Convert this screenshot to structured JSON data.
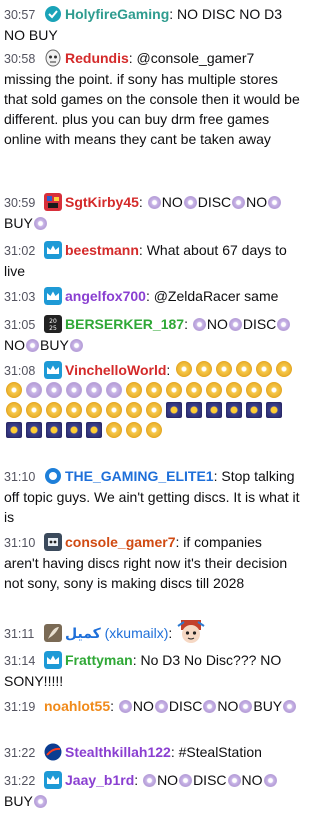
{
  "messages": [
    {
      "time": "30:57",
      "user": "HolyfireGaming",
      "color": "#2e9c8f",
      "badge": "circle-teal",
      "parts": [
        {
          "t": "text",
          "v": ": NO DISC NO D3 NO BUY"
        }
      ]
    },
    {
      "time": "30:58",
      "user": "Redundis",
      "color": "#d42a2a",
      "badge": "mask",
      "parts": [
        {
          "t": "text",
          "v": ": @console_gamer7 missing the point. if sony has multiple stores that sold games on the console then it would be different. plus you can buy drm free games online with means they cant be taken away"
        }
      ]
    },
    {
      "time": "30:59",
      "user": "SgtKirby45",
      "color": "#d42a2a",
      "badge": "pixel",
      "parts": [
        {
          "t": "text",
          "v": ": "
        },
        {
          "t": "emote"
        },
        {
          "t": "text",
          "v": "NO"
        },
        {
          "t": "emote"
        },
        {
          "t": "text",
          "v": "DISC"
        },
        {
          "t": "emote"
        },
        {
          "t": "text",
          "v": "NO"
        },
        {
          "t": "emote"
        },
        {
          "t": "text",
          "v": "BUY"
        },
        {
          "t": "emote"
        }
      ]
    },
    {
      "time": "31:02",
      "user": "beestmann",
      "color": "#d42a2a",
      "badge": "crown",
      "parts": [
        {
          "t": "text",
          "v": ": What about 67 days to live"
        }
      ]
    },
    {
      "time": "31:03",
      "user": "angelfox700",
      "color": "#8a3fd1",
      "badge": "crown",
      "parts": [
        {
          "t": "text",
          "v": ": @ZeldaRacer same"
        }
      ]
    },
    {
      "time": "31:05",
      "user": "BERSERKER_187",
      "color": "#2fa836",
      "badge": "dark",
      "parts": [
        {
          "t": "text",
          "v": ": "
        },
        {
          "t": "emote"
        },
        {
          "t": "text",
          "v": "NO"
        },
        {
          "t": "emote"
        },
        {
          "t": "text",
          "v": "DISC"
        },
        {
          "t": "emote"
        },
        {
          "t": "text",
          "v": "NO"
        },
        {
          "t": "emote"
        },
        {
          "t": "text",
          "v": "BUY"
        },
        {
          "t": "emote"
        }
      ]
    },
    {
      "time": "31:08",
      "user": "VinchelloWorld",
      "color": "#d42a2a",
      "badge": "crown",
      "parts": [
        {
          "t": "text",
          "v": ": "
        }
      ],
      "emote_rows": [
        [
          "gold",
          "gold",
          "gold",
          "gold",
          "gold",
          "gold"
        ],
        [
          "gold",
          "emote",
          "emote",
          "emote",
          "emote",
          "emote",
          "gold",
          "gold",
          "gold",
          "gold",
          "gold",
          "gold"
        ],
        [
          "gold",
          "gold",
          "gold",
          "gold",
          "gold",
          "gold",
          "gold",
          "gold",
          "gold",
          "gold",
          "blue",
          "blue"
        ],
        [
          "blue",
          "blue",
          "blue",
          "blue",
          "blue",
          "blue",
          "blue",
          "blue",
          "blue",
          "gold",
          "gold",
          "gold"
        ]
      ]
    },
    {
      "time": "31:10",
      "user": "THE_GAMING_ELITE1",
      "color": "#1e6fd9",
      "badge": "circle-blue",
      "parts": [
        {
          "t": "text",
          "v": ": Stop talking off topic guys. We ain't getting discs. It is what it is"
        }
      ]
    },
    {
      "time": "31:10",
      "user": "console_gamer7",
      "color": "#d04a12",
      "badge": "robot",
      "parts": [
        {
          "t": "text",
          "v": ": if companies aren't having discs right now it's their decision not sony, sony is making discs till 2028"
        }
      ]
    },
    {
      "time": "31:11",
      "user": "كميل",
      "user_suffix": " (xkumailx)",
      "color": "#1e6fd9",
      "badge": "feather",
      "parts": [
        {
          "t": "text",
          "v": ": "
        },
        {
          "t": "anime"
        }
      ]
    },
    {
      "time": "31:14",
      "user": "Frattyman",
      "color": "#2fa836",
      "badge": "crown",
      "parts": [
        {
          "t": "text",
          "v": ": No D3 No Disc??? NO SONY!!!!!"
        }
      ]
    },
    {
      "time": "31:19",
      "user": "noahlot55",
      "color": "#f08a1a",
      "badge": "none",
      "parts": [
        {
          "t": "text",
          "v": ": "
        },
        {
          "t": "emote"
        },
        {
          "t": "text",
          "v": "NO"
        },
        {
          "t": "emote"
        },
        {
          "t": "text",
          "v": "DISC"
        },
        {
          "t": "emote"
        },
        {
          "t": "text",
          "v": "NO"
        },
        {
          "t": "emote"
        },
        {
          "t": "text",
          "v": "BUY"
        },
        {
          "t": "emote"
        }
      ]
    },
    {
      "time": "31:22",
      "user": "Stealthkillah122",
      "color": "#8a3fd1",
      "badge": "nasa",
      "parts": [
        {
          "t": "text",
          "v": ": #StealStation"
        }
      ]
    },
    {
      "time": "31:22",
      "user": "Jaay_b1rd",
      "color": "#8a3fd1",
      "badge": "crown",
      "parts": [
        {
          "t": "text",
          "v": ": "
        },
        {
          "t": "emote"
        },
        {
          "t": "text",
          "v": "NO"
        },
        {
          "t": "emote"
        },
        {
          "t": "text",
          "v": "DISC"
        },
        {
          "t": "emote"
        },
        {
          "t": "text",
          "v": "NO"
        },
        {
          "t": "emote"
        },
        {
          "t": "text",
          "v": "BUY"
        },
        {
          "t": "emote"
        }
      ]
    }
  ]
}
